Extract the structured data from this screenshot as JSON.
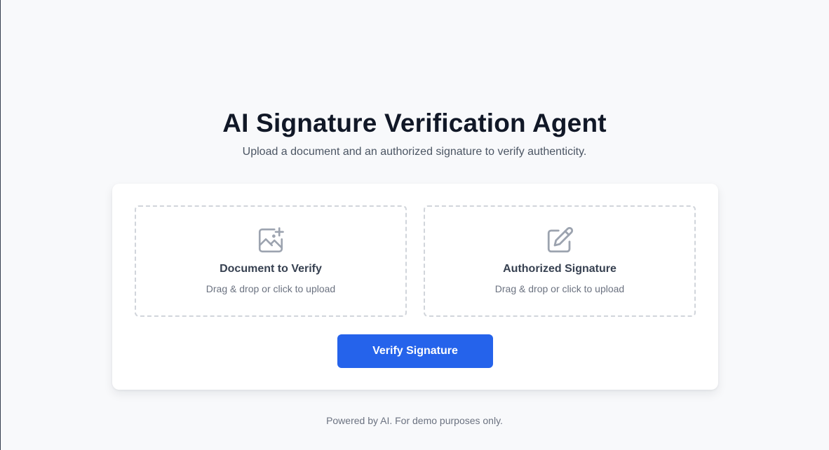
{
  "header": {
    "title": "AI Signature Verification Agent",
    "subtitle": "Upload a document and an authorized signature to verify authenticity."
  },
  "upload": {
    "document": {
      "icon": "image-plus-icon",
      "title": "Document to Verify",
      "hint": "Drag & drop or click to upload"
    },
    "signature": {
      "icon": "pencil-square-icon",
      "title": "Authorized Signature",
      "hint": "Drag & drop or click to upload"
    }
  },
  "actions": {
    "verify_label": "Verify Signature"
  },
  "footer": {
    "text": "Powered by AI. For demo purposes only."
  },
  "colors": {
    "accent": "#2563eb",
    "background": "#f8f9fb",
    "icon": "#9ca3af"
  }
}
